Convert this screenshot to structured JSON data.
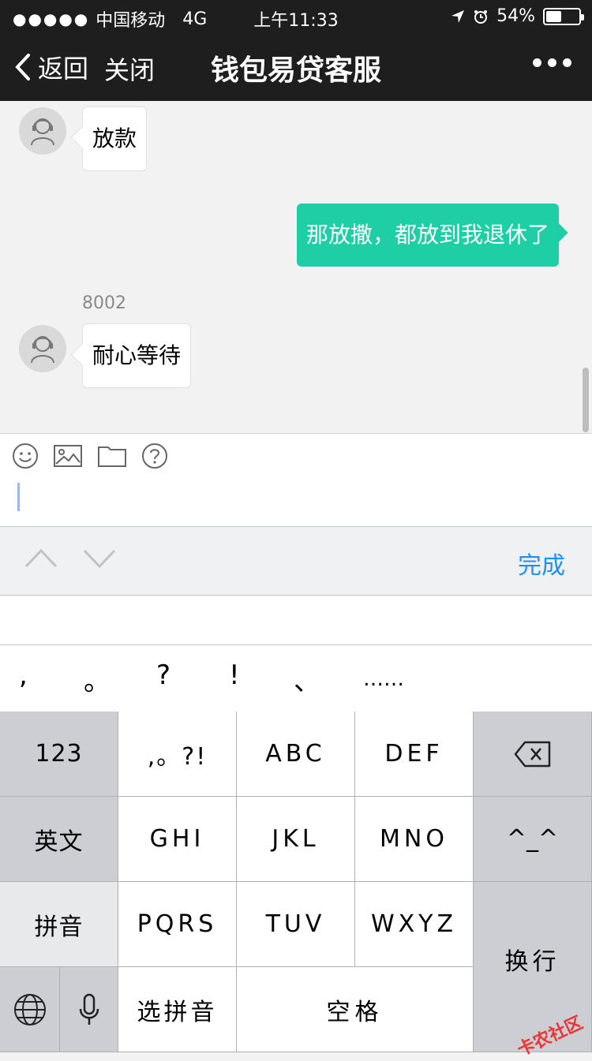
{
  "status": {
    "carrier": "中国移动",
    "network": "4G",
    "time": "上午11:33",
    "battery": "54%",
    "battery_level": 0.54
  },
  "nav": {
    "back_label": "返回",
    "close_label": "关闭",
    "title": "钱包易贷客服"
  },
  "chat": {
    "messages": [
      {
        "side": "left",
        "text": "放款"
      },
      {
        "side": "right",
        "text": "那放撒，都放到我退休了"
      },
      {
        "side": "left",
        "sender": "8002",
        "text": "耐心等待"
      }
    ]
  },
  "toolbar": {
    "done_label": "完成"
  },
  "punctuation": [
    ",",
    "。",
    "?",
    "!",
    "、",
    "……"
  ],
  "keyboard": {
    "row1": [
      "123",
      ",。?!",
      "ABC",
      "DEF"
    ],
    "row2": [
      "英文",
      "GHI",
      "JKL",
      "MNO",
      "^_^"
    ],
    "row3": [
      "拼音",
      "PQRS",
      "TUV",
      "WXYZ"
    ],
    "row4": [
      "选拼音",
      "空格"
    ],
    "return_label": "换行"
  },
  "watermark": "卡农社区",
  "colors": {
    "header_bg": "#1e1e1e",
    "bubble_out": "#1ecfa6",
    "accent": "#1a8fff"
  }
}
